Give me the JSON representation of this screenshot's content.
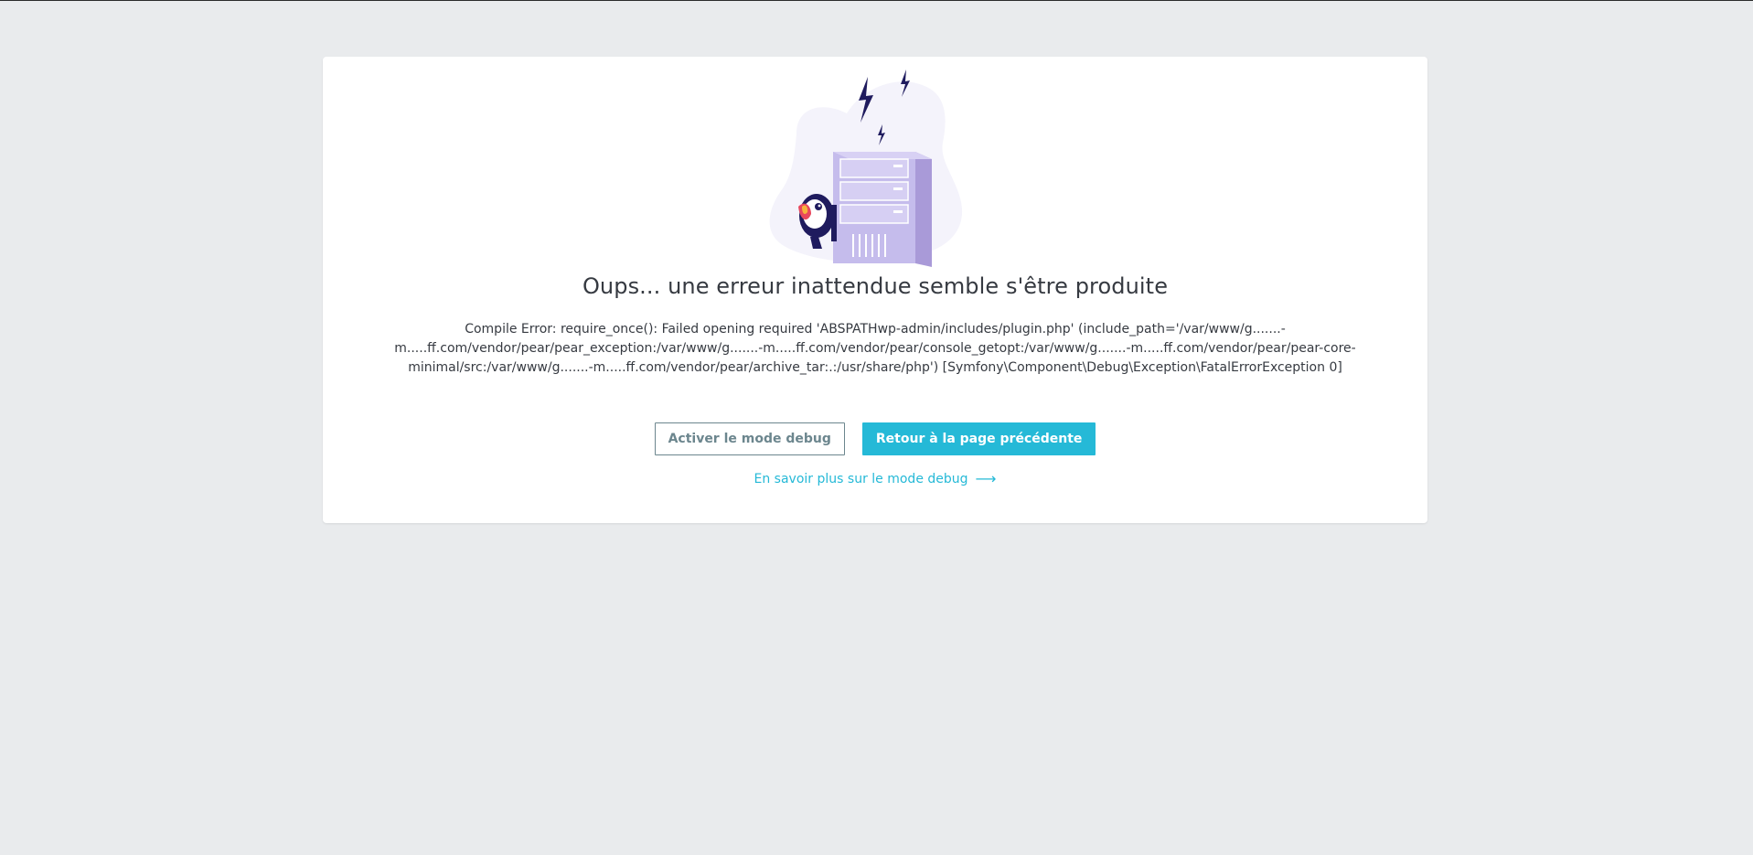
{
  "page": {
    "title": "Oups... une erreur inattendue semble s'être produite",
    "error_message": "Compile Error: require_once(): Failed opening required 'ABSPATHwp-admin/includes/plugin.php' (include_path='/var/www/g.......-m.....ff.com/vendor/pear/pear_exception:/var/www/g.......-m.....ff.com/vendor/pear/console_getopt:/var/www/g.......-m.....ff.com/vendor/pear/pear-core-minimal/src:/var/www/g.......-m.....ff.com/vendor/pear/archive_tar:.:/usr/share/php') [Symfony\\Component\\Debug\\Exception\\FatalErrorException 0]",
    "buttons": {
      "debug_label": "Activer le mode debug",
      "back_label": "Retour à la page précédente"
    },
    "learn_more": {
      "label": "En savoir plus sur le mode debug",
      "arrow": "⟶"
    }
  },
  "colors": {
    "background": "#e9ebed",
    "card": "#ffffff",
    "text": "#363a41",
    "primary": "#25b9d7",
    "outline": "#6c868e",
    "illustration_blob": "#f4f3fb",
    "server": "#c5bcec",
    "lightning": "#1f1b5e"
  },
  "icons": {
    "illustration": "server-error-illustration",
    "arrow": "arrow-right-icon"
  }
}
